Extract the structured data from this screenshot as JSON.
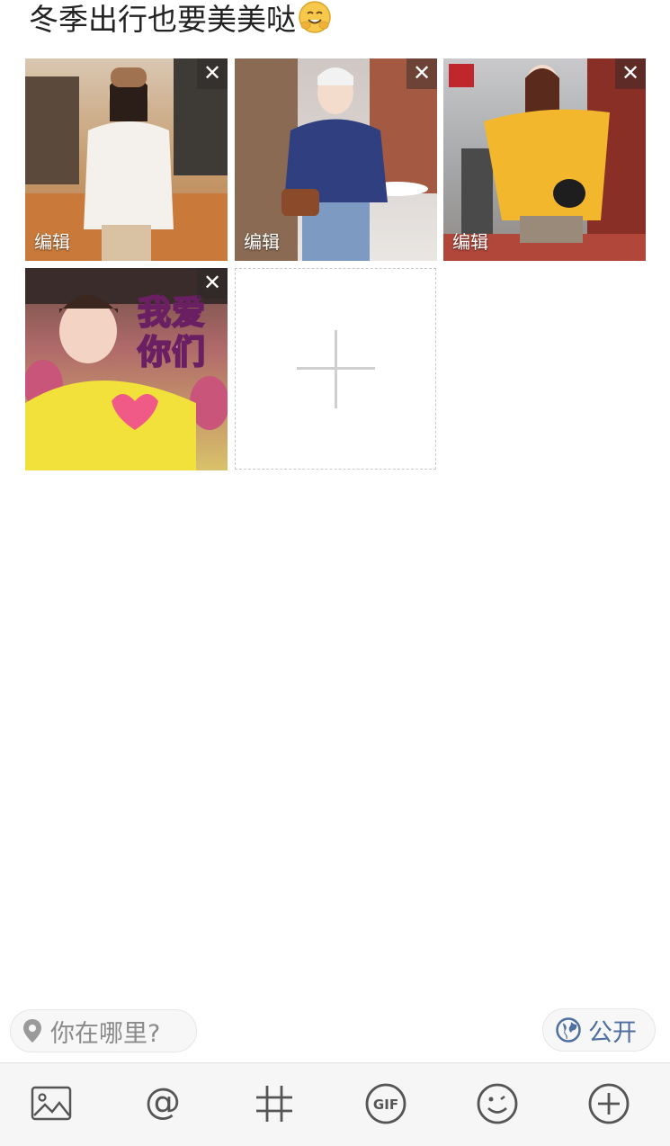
{
  "post": {
    "text": "冬季出行也要美美哒"
  },
  "photos": [
    {
      "edit_label": "编辑",
      "close_glyph": "✕"
    },
    {
      "edit_label": "编辑",
      "close_glyph": "✕"
    },
    {
      "edit_label": "编辑",
      "close_glyph": "✕"
    },
    {
      "close_glyph": "✕",
      "meme_text_line1": "我爱",
      "meme_text_line2": "你们"
    }
  ],
  "add_photo": {
    "icon": "plus-icon"
  },
  "location": {
    "placeholder": "你在哪里?",
    "icon": "location-pin-icon"
  },
  "visibility": {
    "label": "公开",
    "icon": "globe-icon"
  },
  "toolbar": {
    "items": [
      {
        "icon": "image-icon"
      },
      {
        "icon": "at-mention-icon"
      },
      {
        "icon": "hashtag-icon"
      },
      {
        "icon": "gif-icon"
      },
      {
        "icon": "emoji-icon"
      },
      {
        "icon": "add-circle-icon"
      }
    ]
  },
  "colors": {
    "accent_blue": "#4f6fa0",
    "toolbar_bg": "#f6f6f6"
  }
}
